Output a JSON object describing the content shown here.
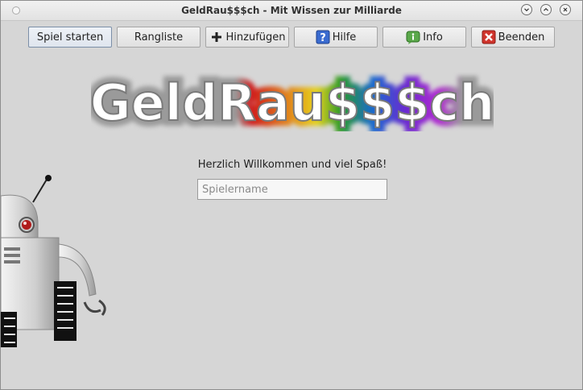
{
  "window": {
    "title": "GeldRau$$$ch - Mit Wissen zur Milliarde"
  },
  "toolbar": {
    "buttons": [
      {
        "label": "Spiel starten",
        "icon": ""
      },
      {
        "label": "Rangliste",
        "icon": ""
      },
      {
        "label": "Hinzufügen",
        "icon": "plus-icon"
      },
      {
        "label": "Hilfe",
        "icon": "help-icon"
      },
      {
        "label": "Info",
        "icon": "info-icon"
      },
      {
        "label": "Beenden",
        "icon": "close-icon"
      }
    ]
  },
  "logo": {
    "text": "GeldRau$$$ch"
  },
  "main": {
    "welcome": "Herzlich Willkommen und viel Spaß!",
    "player_name": {
      "value": "",
      "placeholder": "Spielername"
    }
  },
  "colors": {
    "help_icon": "#3a6bd0",
    "info_icon": "#5aa84a",
    "close_icon": "#d0342c",
    "rainbow": [
      "#d01c1c",
      "#e07a1a",
      "#e6d21c",
      "#2a9a2a",
      "#1c6ad0",
      "#6a2ad0",
      "#b02ad0"
    ]
  }
}
